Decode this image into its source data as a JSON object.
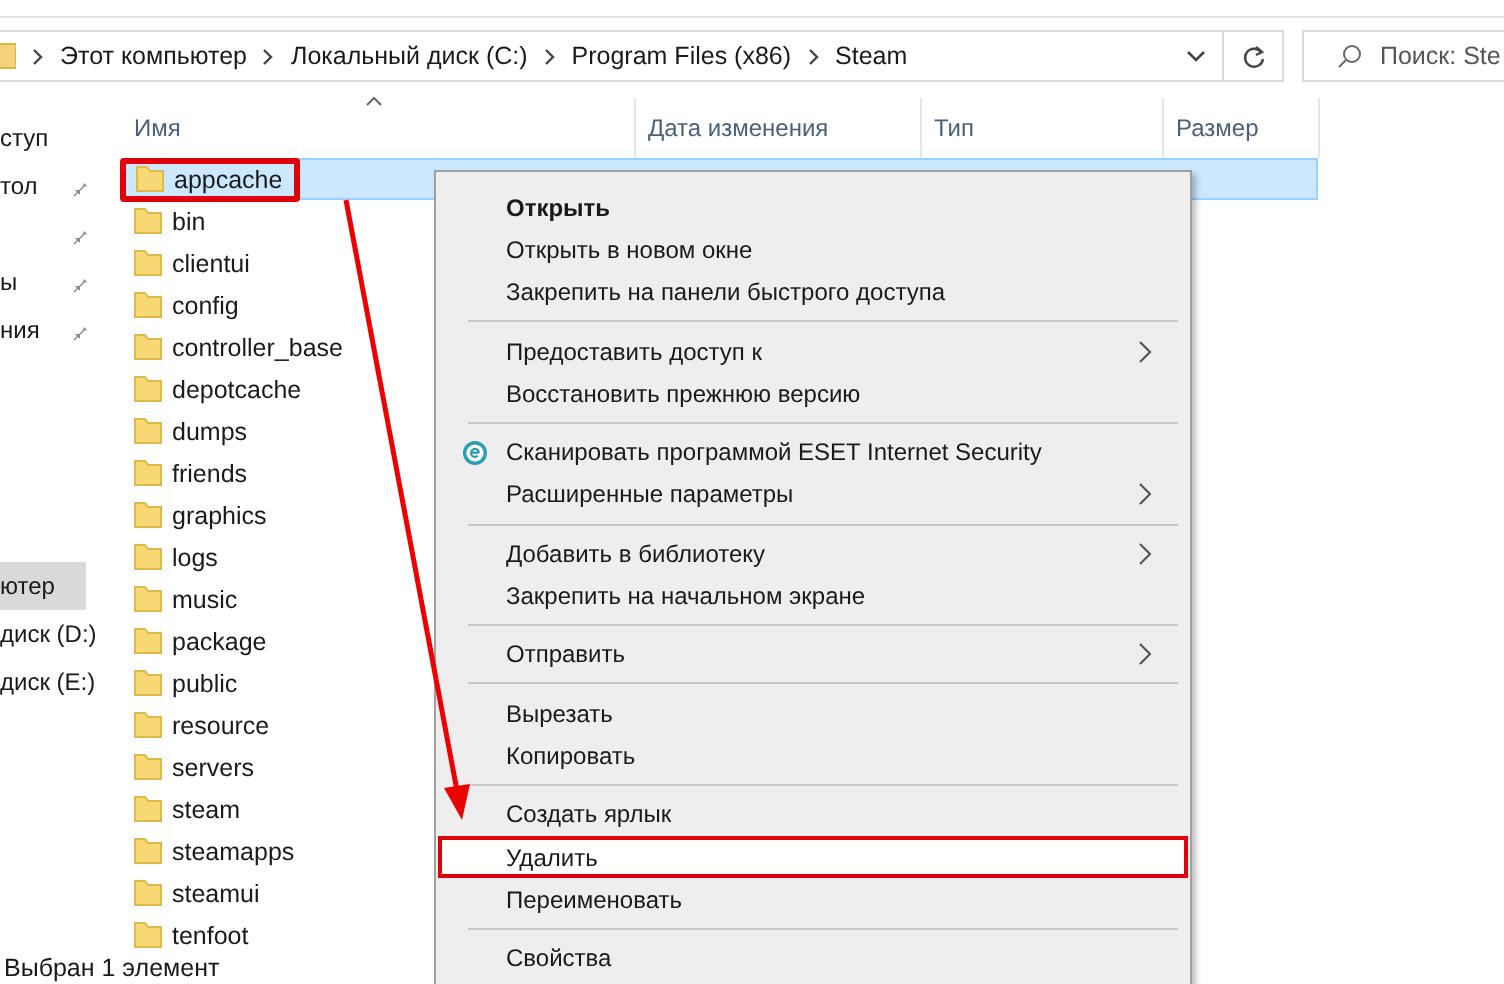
{
  "address_bar": {
    "breadcrumb": [
      "Этот компьютер",
      "Локальный диск (C:)",
      "Program Files (x86)",
      "Steam"
    ]
  },
  "search": {
    "placeholder": "Поиск: Ste"
  },
  "sidebar": {
    "items": [
      {
        "label": "ступ",
        "pinned": false,
        "selected": false
      },
      {
        "label": "тол",
        "pinned": true,
        "selected": false
      },
      {
        "pinned": true,
        "selected": false
      },
      {
        "label": "ы",
        "pinned": true,
        "selected": false
      },
      {
        "label": "ния",
        "pinned": true,
        "selected": false
      },
      {
        "label": "ютер",
        "pinned": false,
        "selected": true
      },
      {
        "label": "диск (D:)",
        "pinned": false,
        "selected": false
      },
      {
        "label": "диск (E:)",
        "pinned": false,
        "selected": false
      }
    ]
  },
  "table": {
    "columns": [
      "Имя",
      "Дата изменения",
      "Тип",
      "Размер"
    ],
    "rows": [
      {
        "name": "appcache",
        "selected": true,
        "highlighted": true
      },
      {
        "name": "bin",
        "selected": false,
        "highlighted": false
      },
      {
        "name": "clientui",
        "selected": false,
        "highlighted": false
      },
      {
        "name": "config",
        "selected": false,
        "highlighted": false
      },
      {
        "name": "controller_base",
        "selected": false,
        "highlighted": false
      },
      {
        "name": "depotcache",
        "selected": false,
        "highlighted": false
      },
      {
        "name": "dumps",
        "selected": false,
        "highlighted": false
      },
      {
        "name": "friends",
        "selected": false,
        "highlighted": false
      },
      {
        "name": "graphics",
        "selected": false,
        "highlighted": false
      },
      {
        "name": "logs",
        "selected": false,
        "highlighted": false
      },
      {
        "name": "music",
        "selected": false,
        "highlighted": false
      },
      {
        "name": "package",
        "selected": false,
        "highlighted": false
      },
      {
        "name": "public",
        "selected": false,
        "highlighted": false
      },
      {
        "name": "resource",
        "selected": false,
        "highlighted": false
      },
      {
        "name": "servers",
        "selected": false,
        "highlighted": false
      },
      {
        "name": "steam",
        "selected": false,
        "highlighted": false
      },
      {
        "name": "steamapps",
        "selected": false,
        "highlighted": false
      },
      {
        "name": "steamui",
        "selected": false,
        "highlighted": false
      },
      {
        "name": "tenfoot",
        "selected": false,
        "highlighted": false
      }
    ]
  },
  "context_menu": {
    "items": [
      {
        "kind": "item",
        "label": "Открыть",
        "bold": true,
        "submenu": false,
        "icon": false,
        "highlighted": false
      },
      {
        "kind": "item",
        "label": "Открыть в новом окне",
        "bold": false,
        "submenu": false,
        "icon": false,
        "highlighted": false
      },
      {
        "kind": "item",
        "label": "Закрепить на панели быстрого доступа",
        "bold": false,
        "submenu": false,
        "icon": false,
        "highlighted": false
      },
      {
        "kind": "separator"
      },
      {
        "kind": "item",
        "label": "Предоставить доступ к",
        "bold": false,
        "submenu": true,
        "icon": false,
        "highlighted": false
      },
      {
        "kind": "item",
        "label": "Восстановить прежнюю версию",
        "bold": false,
        "submenu": false,
        "icon": false,
        "highlighted": false
      },
      {
        "kind": "separator"
      },
      {
        "kind": "item",
        "label": "Сканировать программой ESET Internet Security",
        "bold": false,
        "submenu": false,
        "icon": true,
        "highlighted": false
      },
      {
        "kind": "item",
        "label": "Расширенные параметры",
        "bold": false,
        "submenu": true,
        "icon": false,
        "highlighted": false
      },
      {
        "kind": "separator"
      },
      {
        "kind": "item",
        "label": "Добавить в библиотеку",
        "bold": false,
        "submenu": true,
        "icon": false,
        "highlighted": false
      },
      {
        "kind": "item",
        "label": "Закрепить на начальном экране",
        "bold": false,
        "submenu": false,
        "icon": false,
        "highlighted": false
      },
      {
        "kind": "separator"
      },
      {
        "kind": "item",
        "label": "Отправить",
        "bold": false,
        "submenu": true,
        "icon": false,
        "highlighted": false
      },
      {
        "kind": "separator"
      },
      {
        "kind": "item",
        "label": "Вырезать",
        "bold": false,
        "submenu": false,
        "icon": false,
        "highlighted": false
      },
      {
        "kind": "item",
        "label": "Копировать",
        "bold": false,
        "submenu": false,
        "icon": false,
        "highlighted": false
      },
      {
        "kind": "separator"
      },
      {
        "kind": "item",
        "label": "Создать ярлык",
        "bold": false,
        "submenu": false,
        "icon": false,
        "highlighted": false
      },
      {
        "kind": "item",
        "label": "Удалить",
        "bold": false,
        "submenu": false,
        "icon": false,
        "highlighted": true
      },
      {
        "kind": "item",
        "label": "Переименовать",
        "bold": false,
        "submenu": false,
        "icon": false,
        "highlighted": false
      },
      {
        "kind": "separator"
      },
      {
        "kind": "item",
        "label": "Свойства",
        "bold": false,
        "submenu": false,
        "icon": false,
        "highlighted": false
      }
    ]
  },
  "status_bar": {
    "text": "Выбран 1 элемент"
  }
}
